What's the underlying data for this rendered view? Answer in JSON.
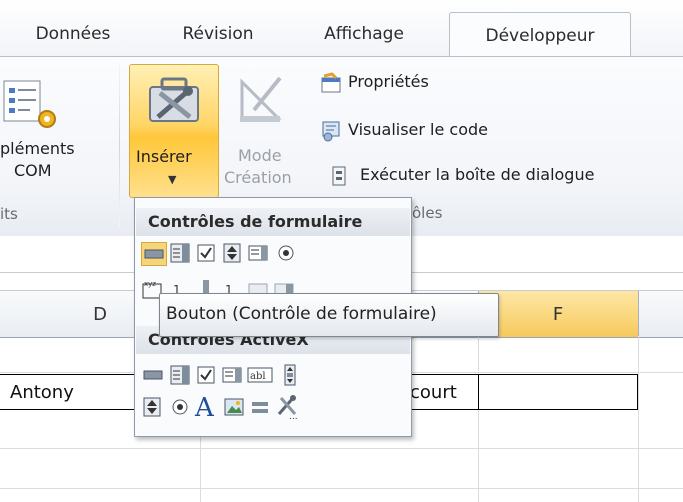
{
  "tabs": [
    "Données",
    "Révision",
    "Affichage",
    "Développeur"
  ],
  "active_tab": "Développeur",
  "ribbon": {
    "complements_line1": "pléments",
    "complements_line2": "COM",
    "group_left_label": "its",
    "insert_label": "Insérer",
    "mode_line1": "Mode",
    "mode_line2": "Création",
    "properties": "Propriétés",
    "view_code": "Visualiser le code",
    "run_dialog": "Exécuter la boîte de dialogue",
    "group_controls_label": "ôles"
  },
  "dropdown": {
    "form_controls_title": "Contrôles de formulaire",
    "activex_controls_title": "Contrôles ActiveX",
    "form_controls": [
      "button-icon",
      "combo-box-icon",
      "checkbox-icon",
      "spin-button-icon",
      "list-box-icon",
      "option-button-icon",
      "group-box-icon",
      "label-icon",
      "scroll-bar-icon",
      "text-field-icon",
      "combo-list-edit-icon",
      "combo-drop-down-icon"
    ],
    "activex_controls": [
      "button-icon",
      "combo-box-icon",
      "checkbox-icon",
      "list-box-icon",
      "text-box-icon",
      "scroll-bar-icon",
      "spin-button-icon",
      "option-button-icon",
      "label-icon",
      "image-icon",
      "toggle-icon",
      "more-controls-icon"
    ]
  },
  "tooltip": "Bouton (Contrôle de formulaire)",
  "sheet": {
    "columns": [
      "D",
      "F"
    ],
    "cells": {
      "d_value": "Antony",
      "e_value": "court"
    }
  },
  "colors": {
    "insert_highlight": "#ffd567",
    "selected_column": "#f7c95c"
  }
}
